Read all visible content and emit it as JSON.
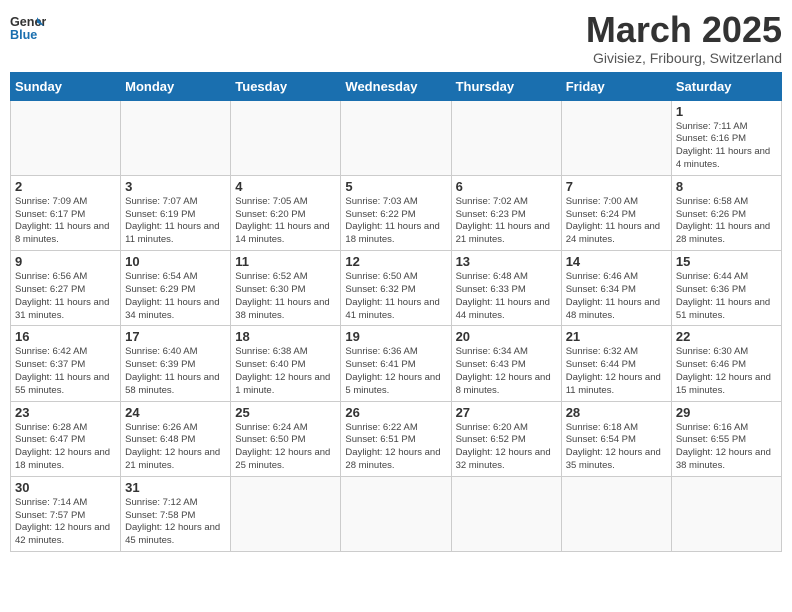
{
  "logo": {
    "line1": "General",
    "line2": "Blue"
  },
  "title": "March 2025",
  "subtitle": "Givisiez, Fribourg, Switzerland",
  "weekdays": [
    "Sunday",
    "Monday",
    "Tuesday",
    "Wednesday",
    "Thursday",
    "Friday",
    "Saturday"
  ],
  "weeks": [
    [
      {
        "day": "",
        "info": ""
      },
      {
        "day": "",
        "info": ""
      },
      {
        "day": "",
        "info": ""
      },
      {
        "day": "",
        "info": ""
      },
      {
        "day": "",
        "info": ""
      },
      {
        "day": "",
        "info": ""
      },
      {
        "day": "1",
        "info": "Sunrise: 7:11 AM\nSunset: 6:16 PM\nDaylight: 11 hours and 4 minutes."
      }
    ],
    [
      {
        "day": "2",
        "info": "Sunrise: 7:09 AM\nSunset: 6:17 PM\nDaylight: 11 hours and 8 minutes."
      },
      {
        "day": "3",
        "info": "Sunrise: 7:07 AM\nSunset: 6:19 PM\nDaylight: 11 hours and 11 minutes."
      },
      {
        "day": "4",
        "info": "Sunrise: 7:05 AM\nSunset: 6:20 PM\nDaylight: 11 hours and 14 minutes."
      },
      {
        "day": "5",
        "info": "Sunrise: 7:03 AM\nSunset: 6:22 PM\nDaylight: 11 hours and 18 minutes."
      },
      {
        "day": "6",
        "info": "Sunrise: 7:02 AM\nSunset: 6:23 PM\nDaylight: 11 hours and 21 minutes."
      },
      {
        "day": "7",
        "info": "Sunrise: 7:00 AM\nSunset: 6:24 PM\nDaylight: 11 hours and 24 minutes."
      },
      {
        "day": "8",
        "info": "Sunrise: 6:58 AM\nSunset: 6:26 PM\nDaylight: 11 hours and 28 minutes."
      }
    ],
    [
      {
        "day": "9",
        "info": "Sunrise: 6:56 AM\nSunset: 6:27 PM\nDaylight: 11 hours and 31 minutes."
      },
      {
        "day": "10",
        "info": "Sunrise: 6:54 AM\nSunset: 6:29 PM\nDaylight: 11 hours and 34 minutes."
      },
      {
        "day": "11",
        "info": "Sunrise: 6:52 AM\nSunset: 6:30 PM\nDaylight: 11 hours and 38 minutes."
      },
      {
        "day": "12",
        "info": "Sunrise: 6:50 AM\nSunset: 6:32 PM\nDaylight: 11 hours and 41 minutes."
      },
      {
        "day": "13",
        "info": "Sunrise: 6:48 AM\nSunset: 6:33 PM\nDaylight: 11 hours and 44 minutes."
      },
      {
        "day": "14",
        "info": "Sunrise: 6:46 AM\nSunset: 6:34 PM\nDaylight: 11 hours and 48 minutes."
      },
      {
        "day": "15",
        "info": "Sunrise: 6:44 AM\nSunset: 6:36 PM\nDaylight: 11 hours and 51 minutes."
      }
    ],
    [
      {
        "day": "16",
        "info": "Sunrise: 6:42 AM\nSunset: 6:37 PM\nDaylight: 11 hours and 55 minutes."
      },
      {
        "day": "17",
        "info": "Sunrise: 6:40 AM\nSunset: 6:39 PM\nDaylight: 11 hours and 58 minutes."
      },
      {
        "day": "18",
        "info": "Sunrise: 6:38 AM\nSunset: 6:40 PM\nDaylight: 12 hours and 1 minute."
      },
      {
        "day": "19",
        "info": "Sunrise: 6:36 AM\nSunset: 6:41 PM\nDaylight: 12 hours and 5 minutes."
      },
      {
        "day": "20",
        "info": "Sunrise: 6:34 AM\nSunset: 6:43 PM\nDaylight: 12 hours and 8 minutes."
      },
      {
        "day": "21",
        "info": "Sunrise: 6:32 AM\nSunset: 6:44 PM\nDaylight: 12 hours and 11 minutes."
      },
      {
        "day": "22",
        "info": "Sunrise: 6:30 AM\nSunset: 6:46 PM\nDaylight: 12 hours and 15 minutes."
      }
    ],
    [
      {
        "day": "23",
        "info": "Sunrise: 6:28 AM\nSunset: 6:47 PM\nDaylight: 12 hours and 18 minutes."
      },
      {
        "day": "24",
        "info": "Sunrise: 6:26 AM\nSunset: 6:48 PM\nDaylight: 12 hours and 21 minutes."
      },
      {
        "day": "25",
        "info": "Sunrise: 6:24 AM\nSunset: 6:50 PM\nDaylight: 12 hours and 25 minutes."
      },
      {
        "day": "26",
        "info": "Sunrise: 6:22 AM\nSunset: 6:51 PM\nDaylight: 12 hours and 28 minutes."
      },
      {
        "day": "27",
        "info": "Sunrise: 6:20 AM\nSunset: 6:52 PM\nDaylight: 12 hours and 32 minutes."
      },
      {
        "day": "28",
        "info": "Sunrise: 6:18 AM\nSunset: 6:54 PM\nDaylight: 12 hours and 35 minutes."
      },
      {
        "day": "29",
        "info": "Sunrise: 6:16 AM\nSunset: 6:55 PM\nDaylight: 12 hours and 38 minutes."
      }
    ],
    [
      {
        "day": "30",
        "info": "Sunrise: 7:14 AM\nSunset: 7:57 PM\nDaylight: 12 hours and 42 minutes."
      },
      {
        "day": "31",
        "info": "Sunrise: 7:12 AM\nSunset: 7:58 PM\nDaylight: 12 hours and 45 minutes."
      },
      {
        "day": "",
        "info": ""
      },
      {
        "day": "",
        "info": ""
      },
      {
        "day": "",
        "info": ""
      },
      {
        "day": "",
        "info": ""
      },
      {
        "day": "",
        "info": ""
      }
    ]
  ]
}
